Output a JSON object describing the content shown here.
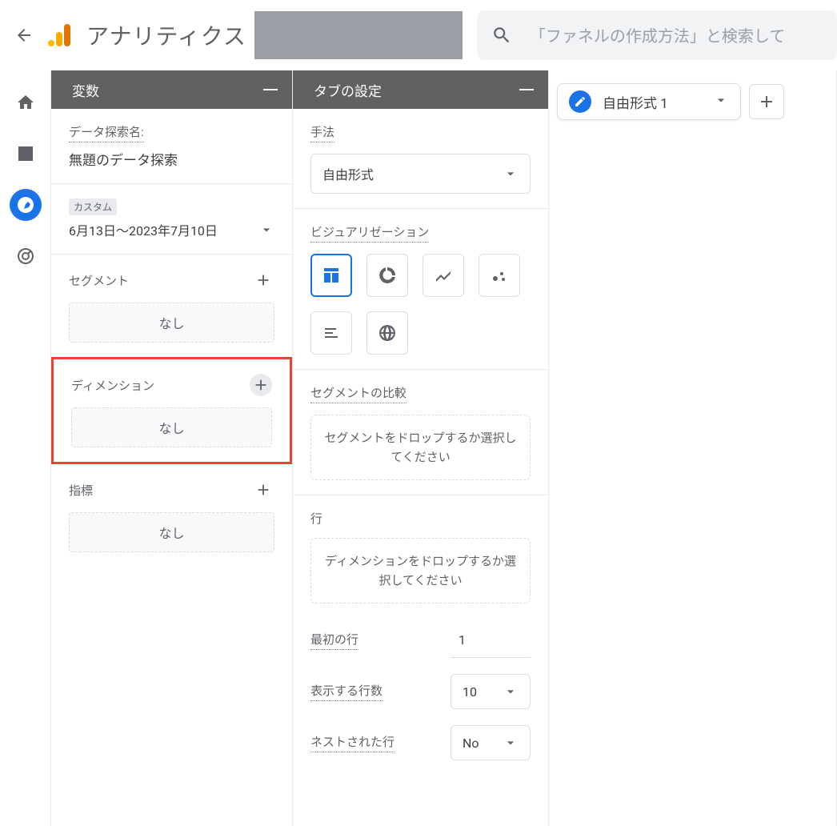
{
  "app": {
    "title": "アナリティクス",
    "search_placeholder": "「ファネルの作成方法」と検索して"
  },
  "panel1": {
    "title": "変数",
    "exploration_label": "データ探索名:",
    "exploration_name": "無題のデータ探索",
    "date_badge": "カスタム",
    "date_range": "6月13日～2023年7月10日",
    "segments": {
      "label": "セグメント",
      "empty": "なし"
    },
    "dimensions": {
      "label": "ディメンション",
      "empty": "なし"
    },
    "metrics": {
      "label": "指標",
      "empty": "なし"
    }
  },
  "panel2": {
    "title": "タブの設定",
    "method": {
      "label": "手法",
      "value": "自由形式"
    },
    "viz_label": "ビジュアリゼーション",
    "seg_compare": {
      "label": "セグメントの比較",
      "drop": "セグメントをドロップするか選択してください"
    },
    "rows": {
      "label": "行",
      "drop": "ディメンションをドロップするか選択してください",
      "first_row_label": "最初の行",
      "first_row_value": "1",
      "show_rows_label": "表示する行数",
      "show_rows_value": "10",
      "nested_label": "ネストされた行",
      "nested_value": "No"
    }
  },
  "tab": {
    "label": "自由形式 1"
  }
}
